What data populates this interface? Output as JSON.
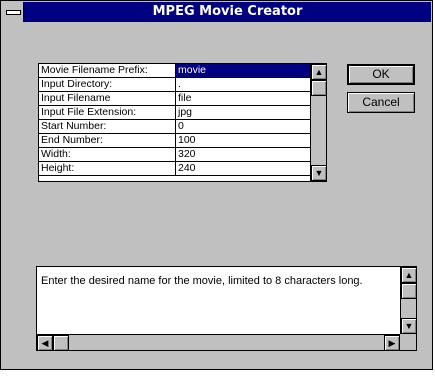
{
  "window": {
    "title": "MPEG Movie Creator"
  },
  "parameters": [
    {
      "label": "Movie Filename Prefix:",
      "value": "movie",
      "selected": true
    },
    {
      "label": "Input Directory:",
      "value": "."
    },
    {
      "label": "Input Filename",
      "value": "file"
    },
    {
      "label": "Input File Extension:",
      "value": "jpg"
    },
    {
      "label": "Start Number:",
      "value": "0"
    },
    {
      "label": "End Number:",
      "value": "100"
    },
    {
      "label": "Width:",
      "value": "320"
    },
    {
      "label": "Height:",
      "value": "240"
    }
  ],
  "buttons": {
    "ok": "OK",
    "cancel": "Cancel"
  },
  "help": {
    "text": "Enter the desired name for the movie, limited to 8 characters long."
  },
  "icons": {
    "up": "up-arrow-icon",
    "down": "down-arrow-icon",
    "left": "left-arrow-icon",
    "right": "right-arrow-icon"
  }
}
